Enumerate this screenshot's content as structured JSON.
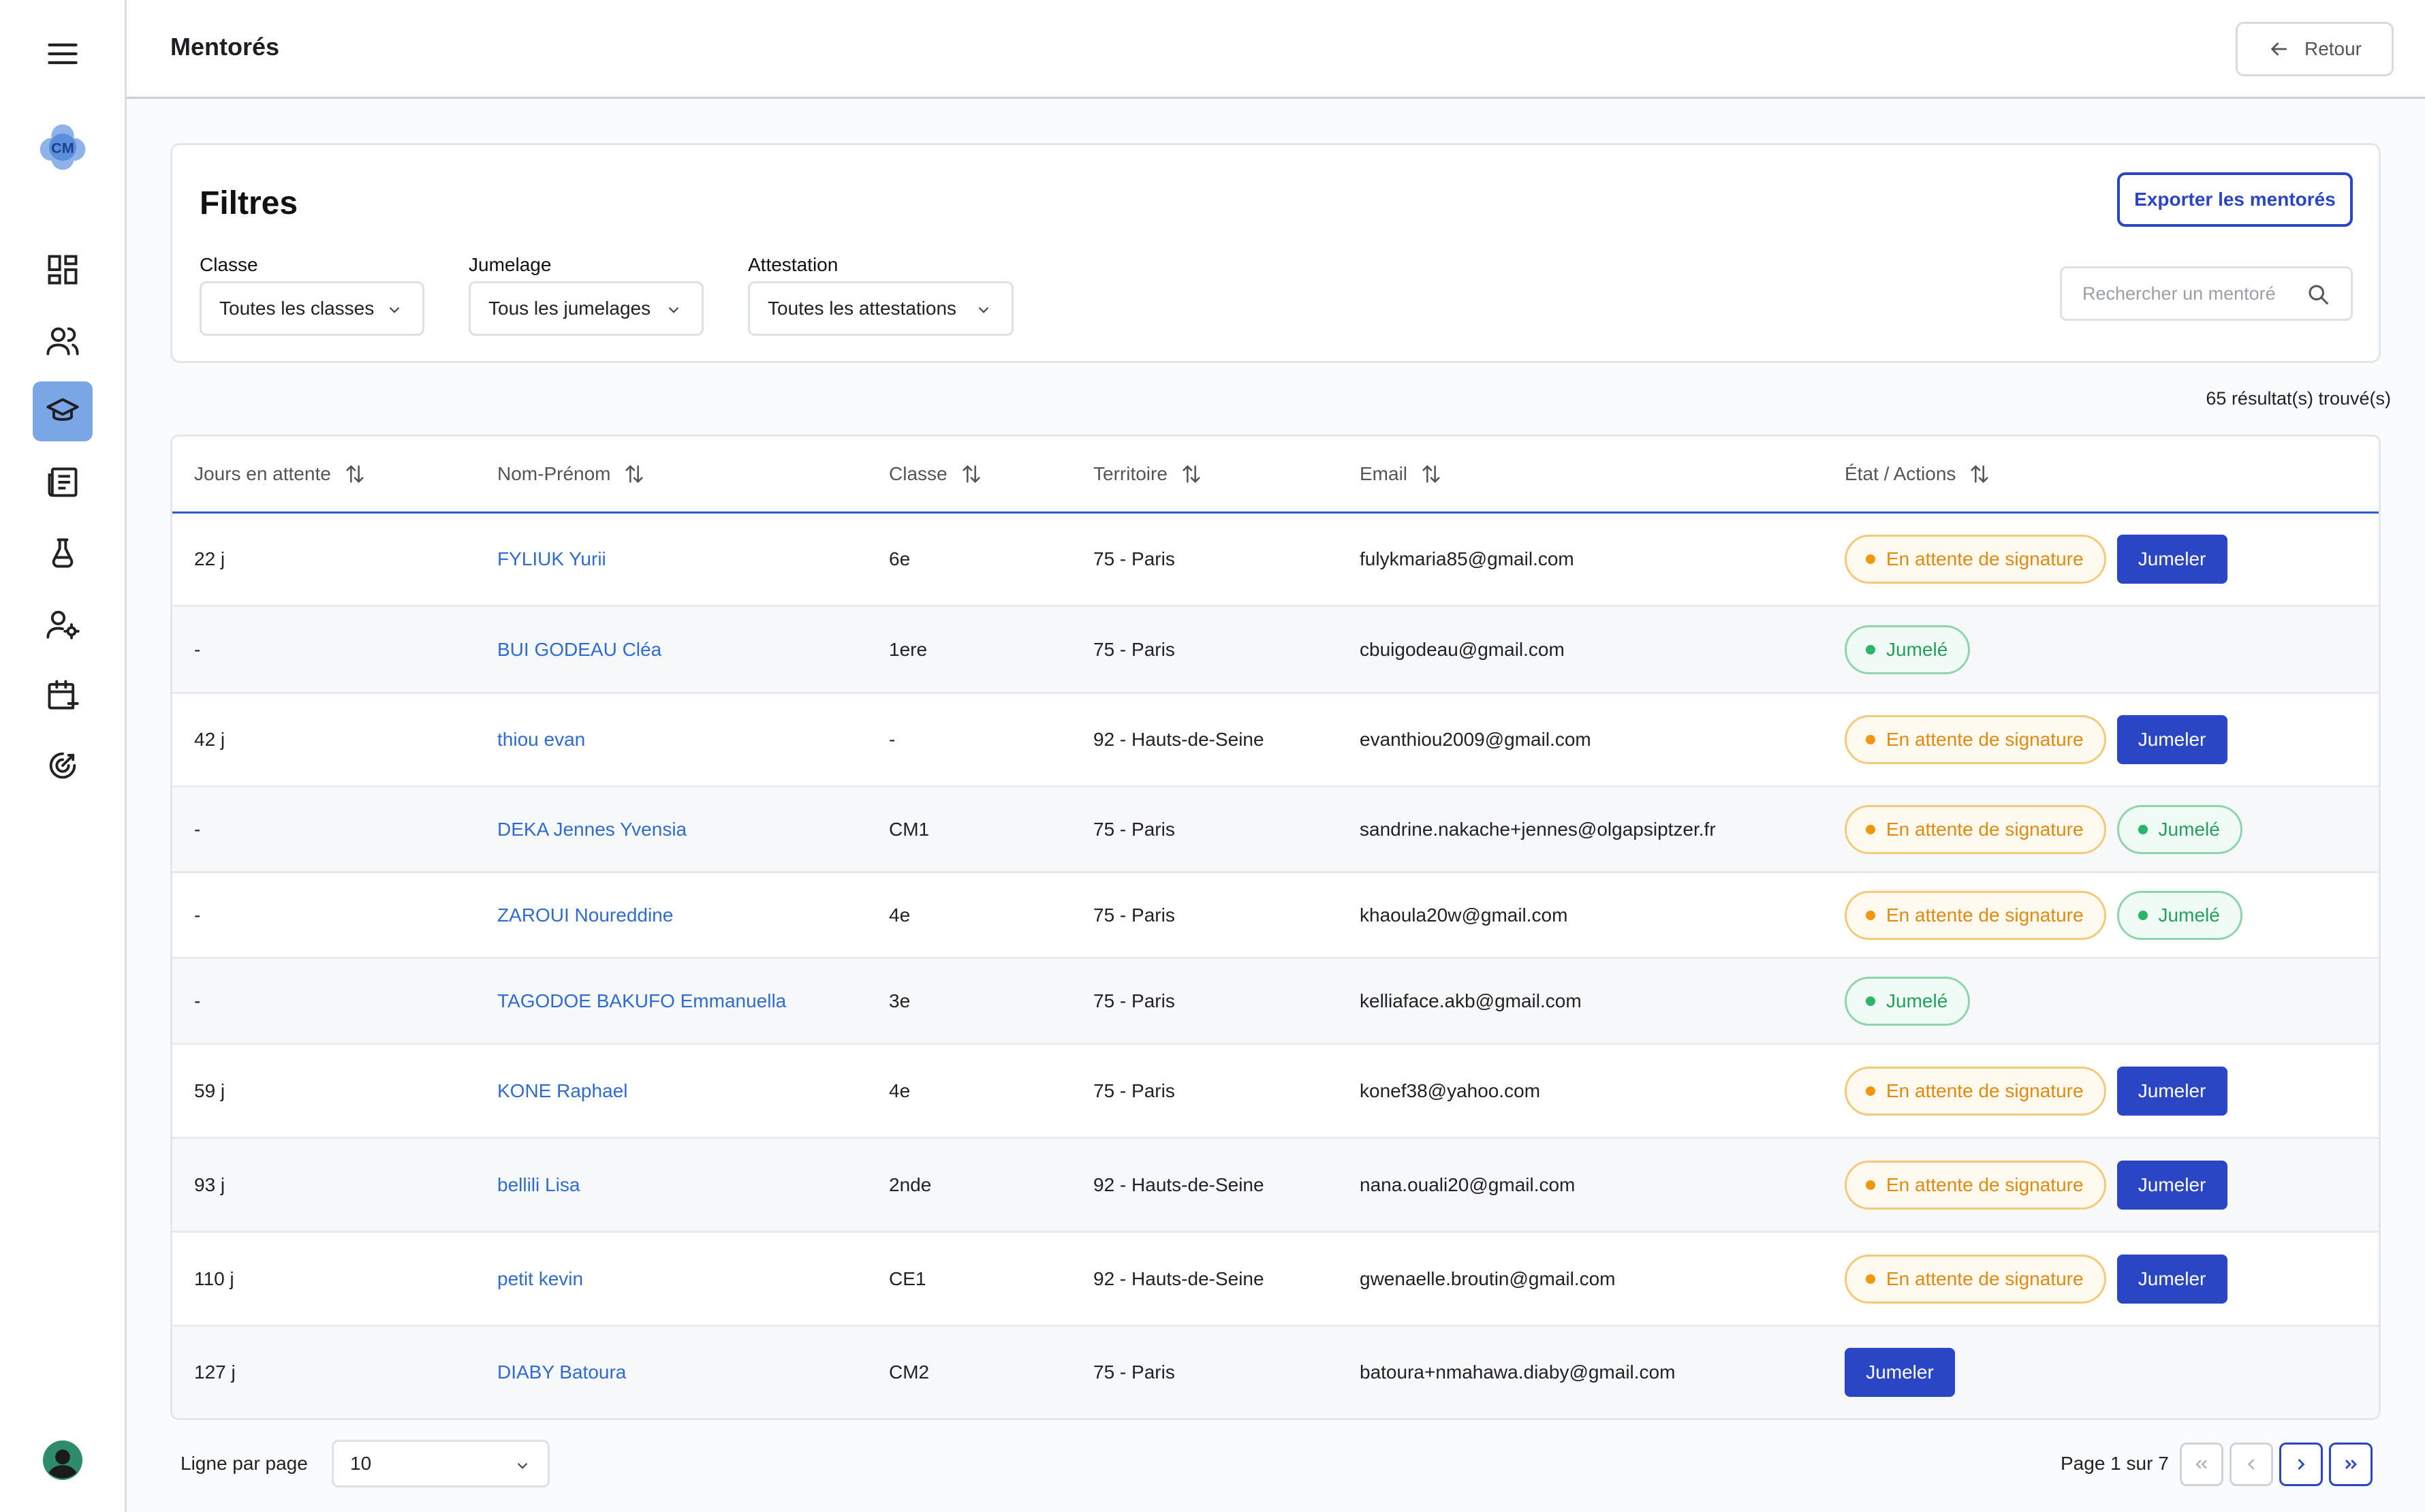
{
  "page": {
    "title": "Mentorés",
    "back_label": "Retour"
  },
  "sidebar": {
    "items": [
      {
        "icon": "menu-icon"
      },
      {
        "icon": "logo-icon"
      },
      {
        "icon": "dashboard-icon"
      },
      {
        "icon": "users-icon"
      },
      {
        "icon": "graduation-cap-icon",
        "active": true
      },
      {
        "icon": "newspaper-icon"
      },
      {
        "icon": "flask-icon"
      },
      {
        "icon": "user-settings-icon"
      },
      {
        "icon": "calendar-plus-icon"
      },
      {
        "icon": "target-icon"
      },
      {
        "icon": "avatar"
      }
    ]
  },
  "filters": {
    "title": "Filtres",
    "export_label": "Exporter les mentorés",
    "classe": {
      "label": "Classe",
      "value": "Toutes les classes"
    },
    "jumelage": {
      "label": "Jumelage",
      "value": "Tous les jumelages"
    },
    "attestation": {
      "label": "Attestation",
      "value": "Toutes les attestations"
    },
    "search_placeholder": "Rechercher un mentoré"
  },
  "results_text": "65 résultat(s) trouvé(s)",
  "table": {
    "columns": [
      "Jours en attente",
      "Nom-Prénom",
      "Classe",
      "Territoire",
      "Email",
      "État / Actions"
    ],
    "rows": [
      {
        "days": "22 j",
        "name": "FYLIUK Yurii",
        "classe": "6e",
        "territoire": "75 - Paris",
        "email": "fulykmaria85@gmail.com",
        "wait": "En attente de signature",
        "ok": "",
        "btn": "Jumeler"
      },
      {
        "days": "-",
        "name": "BUI GODEAU Cléa",
        "classe": "1ere",
        "territoire": "75 - Paris",
        "email": "cbuigodeau@gmail.com",
        "wait": "",
        "ok": "Jumelé",
        "btn": ""
      },
      {
        "days": "42 j",
        "name": "thiou evan",
        "classe": "-",
        "territoire": "92 - Hauts-de-Seine",
        "email": "evanthiou2009@gmail.com",
        "wait": "En attente de signature",
        "ok": "",
        "btn": "Jumeler"
      },
      {
        "days": "-",
        "name": "DEKA Jennes Yvensia",
        "classe": "CM1",
        "territoire": "75 - Paris",
        "email": "sandrine.nakache+jennes@olgapsiptzer.fr",
        "wait": "En attente de signature",
        "ok": "Jumelé",
        "btn": ""
      },
      {
        "days": "-",
        "name": "ZAROUI Noureddine",
        "classe": "4e",
        "territoire": "75 - Paris",
        "email": "khaoula20w@gmail.com",
        "wait": "En attente de signature",
        "ok": "Jumelé",
        "btn": ""
      },
      {
        "days": "-",
        "name": "TAGODOE BAKUFO Emmanuella",
        "classe": "3e",
        "territoire": "75 - Paris",
        "email": "kelliaface.akb@gmail.com",
        "wait": "",
        "ok": "Jumelé",
        "btn": ""
      },
      {
        "days": "59 j",
        "name": "KONE Raphael",
        "classe": "4e",
        "territoire": "75 - Paris",
        "email": "konef38@yahoo.com",
        "wait": "En attente de signature",
        "ok": "",
        "btn": "Jumeler"
      },
      {
        "days": "93 j",
        "name": "bellili Lisa",
        "classe": "2nde",
        "territoire": "92 - Hauts-de-Seine",
        "email": "nana.ouali20@gmail.com",
        "wait": "En attente de signature",
        "ok": "",
        "btn": "Jumeler"
      },
      {
        "days": "110 j",
        "name": "petit kevin",
        "classe": "CE1",
        "territoire": "92 - Hauts-de-Seine",
        "email": "gwenaelle.broutin@gmail.com",
        "wait": "En attente de signature",
        "ok": "",
        "btn": "Jumeler"
      },
      {
        "days": "127 j",
        "name": "DIABY Batoura",
        "classe": "CM2",
        "territoire": "75 - Paris",
        "email": "batoura+nmahawa.diaby@gmail.com",
        "wait": "",
        "ok": "",
        "btn": "Jumeler"
      }
    ]
  },
  "pagination": {
    "rows_label": "Ligne par page",
    "rows_value": "10",
    "page_info": "Page 1 sur 7"
  },
  "colors": {
    "primary": "#2a46c4",
    "link": "#2f6bd0",
    "warning": "#f0960f",
    "success": "#2bb56a",
    "active_nav": "#7ba6e6"
  }
}
